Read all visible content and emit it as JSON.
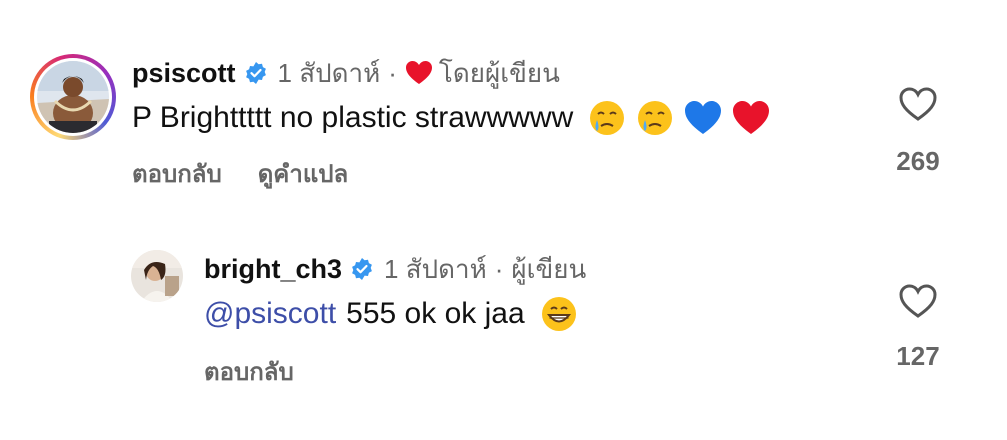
{
  "comments": [
    {
      "username": "psiscott",
      "time": "1 สัปดาห์",
      "separator": "·",
      "liked_by_author": "โดยผู้เขียน",
      "text": "P Brighttttt no plastic strawwwww",
      "emojis": [
        "crying-face",
        "crying-face",
        "blue-heart",
        "red-heart"
      ],
      "actions": [
        "ตอบกลับ",
        "ดูคำแปล"
      ],
      "likes": "269"
    },
    {
      "username": "bright_ch3",
      "time": "1 สัปดาห์",
      "separator": "·",
      "role": "ผู้เขียน",
      "mention": "@psiscott",
      "text": "555 ok ok jaa",
      "emojis": [
        "grinning-face"
      ],
      "actions": [
        "ตอบกลับ"
      ],
      "likes": "127"
    }
  ],
  "colors": {
    "verified": "#3797f0",
    "mention": "#3d4ea8",
    "muted": "#666666",
    "heart": "#e8132b"
  }
}
